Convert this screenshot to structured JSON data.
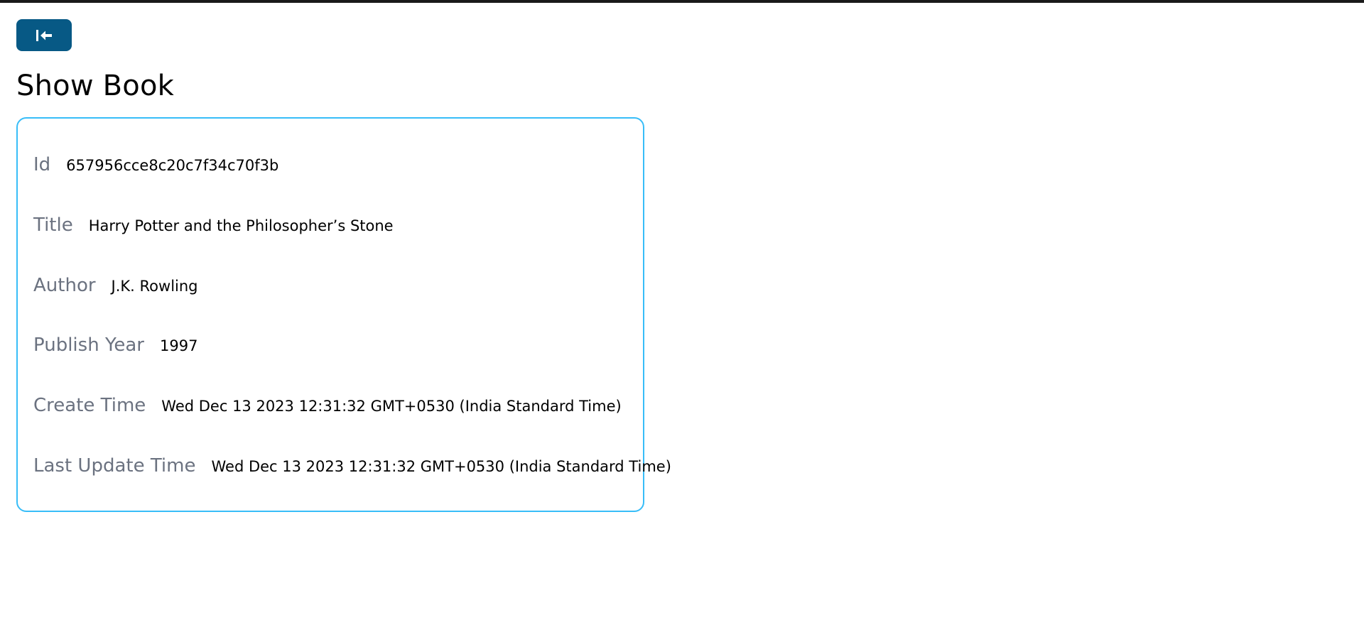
{
  "header": {
    "back_icon": "arrow-left-to-line-icon",
    "back_button_color": "#075985"
  },
  "page": {
    "title": "Show Book"
  },
  "card": {
    "border_color": "#38bdf8",
    "fields": [
      {
        "label": "Id",
        "value": "657956cce8c20c7f34c70f3b"
      },
      {
        "label": "Title",
        "value": "Harry Potter and the Philosopher’s Stone"
      },
      {
        "label": "Author",
        "value": "J.K. Rowling"
      },
      {
        "label": "Publish Year",
        "value": "1997"
      },
      {
        "label": "Create Time",
        "value": "Wed Dec 13 2023 12:31:32 GMT+0530 (India Standard Time)"
      },
      {
        "label": "Last Update Time",
        "value": "Wed Dec 13 2023 12:31:32 GMT+0530 (India Standard Time)"
      }
    ]
  }
}
